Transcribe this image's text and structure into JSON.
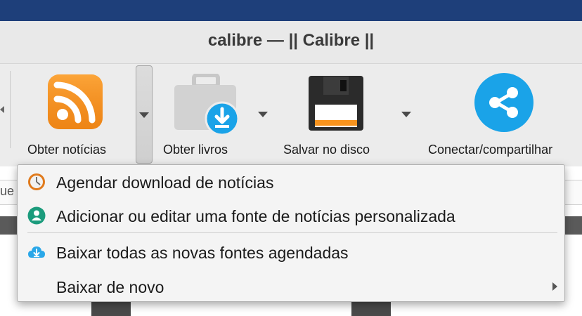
{
  "window": {
    "title": "calibre — || Calibre ||"
  },
  "toolbar": {
    "fetch_news": {
      "label": "Obter notícias",
      "icon": "rss-icon"
    },
    "get_books": {
      "label": "Obter livros",
      "icon": "briefcase-download-icon"
    },
    "save_to_disk": {
      "label": "Salvar no disco",
      "icon": "floppy-disk-icon"
    },
    "connect_share": {
      "label": "Conectar/compartilhar",
      "icon": "share-icon"
    }
  },
  "search": {
    "fragment": "ue"
  },
  "news_menu": {
    "items": [
      {
        "label": "Agendar download de notícias",
        "icon": "clock-icon"
      },
      {
        "label": "Adicionar ou editar uma fonte de notícias personalizada",
        "icon": "user-icon"
      },
      {
        "label": "Baixar todas as novas fontes agendadas",
        "icon": "cloud-download-icon"
      },
      {
        "label": "Baixar de novo",
        "has_submenu": true
      }
    ]
  },
  "colors": {
    "rss": "#f7931e",
    "share": "#1aa3e8",
    "window_top": "#1e3f7a",
    "user_icon": "#1b9b7c"
  }
}
